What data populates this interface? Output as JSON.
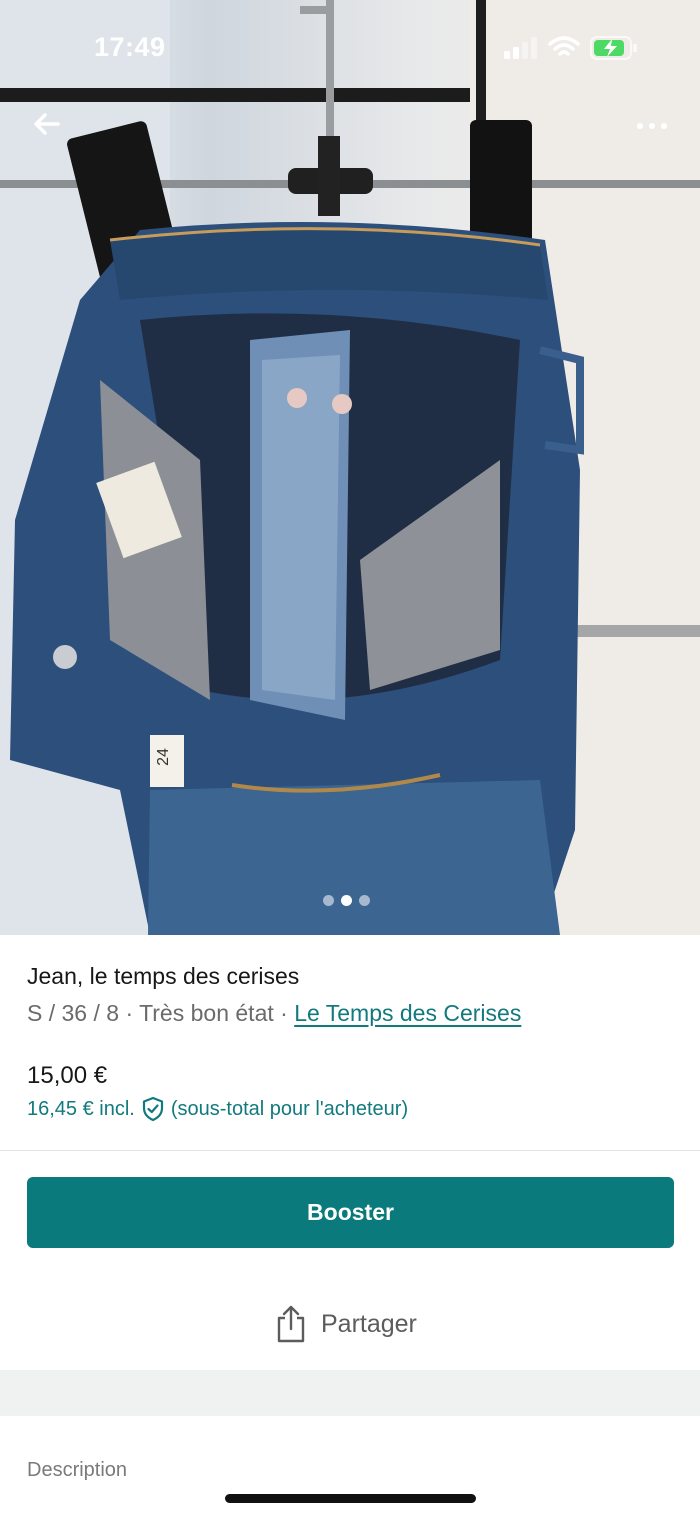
{
  "status_bar": {
    "time": "17:49"
  },
  "listing": {
    "title": "Jean, le temps des cerises",
    "meta_prefix": "S / 36 / 8 · Très bon état · ",
    "brand": "Le Temps des Cerises",
    "price": "15,00 €",
    "price_incl": "16,45 € incl.",
    "price_incl_note": "(sous-total pour l'acheteur)"
  },
  "gallery": {
    "page_count": 3,
    "active_index": 1,
    "label_size": "24"
  },
  "actions": {
    "booster_label": "Booster",
    "share_label": "Partager"
  },
  "description": {
    "label": "Description"
  },
  "colors": {
    "accent": "#0b7a7d",
    "link": "#127a7e"
  },
  "icons": {
    "back": "arrow-left-icon",
    "more": "more-horizontal-icon",
    "shield": "shield-check-icon",
    "share": "share-icon"
  }
}
